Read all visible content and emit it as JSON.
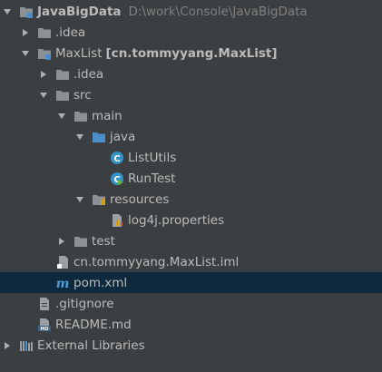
{
  "project": {
    "name": "JavaBigData",
    "path": "D:\\work\\Console\\JavaBigData",
    "idea": ".idea",
    "module": {
      "name": "MaxList",
      "tag": "[cn.tommyyang.MaxList]",
      "idea": ".idea",
      "src": "src",
      "main": "main",
      "java": "java",
      "list_utils": "ListUtils",
      "run_test": "RunTest",
      "resources": "resources",
      "log4j": "log4j.properties",
      "test": "test",
      "iml": "cn.tommyyang.MaxList.iml",
      "pom": "pom.xml"
    },
    "gitignore": ".gitignore",
    "readme": "README.md",
    "external_libraries": "External Libraries"
  },
  "colors": {
    "background": "#3c3f41",
    "selected_row": "#0d293e",
    "text": "#bbbbbb",
    "path_text": "#808080",
    "folder": "#8c9196",
    "source_folder": "#4b8ec9",
    "class_icon": "#3592c4",
    "maven_icon": "#4b9fd5"
  },
  "icons": {
    "project": "project-folder-icon",
    "folder": "folder-icon",
    "source_folder": "source-folder-icon",
    "resources_folder": "resources-folder-icon",
    "class": "java-class-icon",
    "runnable_class": "runnable-class-icon",
    "properties": "properties-file-icon",
    "iml": "iml-file-icon",
    "maven": "maven-icon",
    "text_file": "text-file-icon",
    "markdown": "markdown-file-icon",
    "libraries": "libraries-icon"
  }
}
